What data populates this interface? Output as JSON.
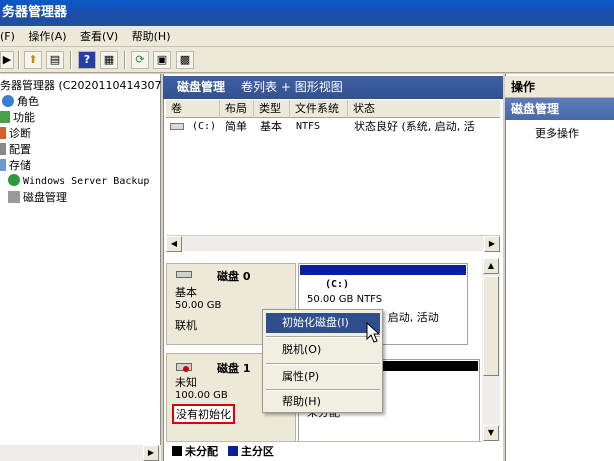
{
  "window": {
    "title": "务器管理器"
  },
  "menu": [
    "(F)",
    "操作(A)",
    "查看(V)",
    "帮助(H)"
  ],
  "tree": {
    "root": "务器管理器 (C2020110414307",
    "items": [
      "角色",
      "功能",
      "诊断",
      "配置",
      "存储"
    ],
    "storage_children": [
      "Windows Server Backup",
      "磁盘管理"
    ]
  },
  "mid_header": {
    "title": "磁盘管理",
    "view": "卷列表 + 图形视图"
  },
  "columns": [
    "卷",
    "布局",
    "类型",
    "文件系统",
    "状态"
  ],
  "volume_row": {
    "icon": "drive-icon",
    "volume": "(C:)",
    "layout": "简单",
    "type": "基本",
    "fs": "NTFS",
    "status": "状态良好 (系统, 启动, 活"
  },
  "disk0": {
    "name": "磁盘 0",
    "kind": "基本",
    "size": "50.00 GB",
    "state": "联机",
    "partition": {
      "label": "(C:)",
      "size_fs": "50.00 GB NTFS",
      "status": "状态良好 (系统, 启动, 活动"
    }
  },
  "disk1": {
    "name": "磁盘 1",
    "kind": "未知",
    "size": "100.00 GB",
    "state": "没有初始化",
    "partition_label": "未分配"
  },
  "context_menu": {
    "items": [
      "初始化磁盘(I)",
      "脱机(O)",
      "属性(P)",
      "帮助(H)"
    ]
  },
  "legend": {
    "unallocated": "未分配",
    "primary": "主分区"
  },
  "actions": {
    "title": "操作",
    "section": "磁盘管理",
    "more": "更多操作"
  },
  "colors": {
    "title_blue": "#1e4ea8",
    "primary_partition": "#0a1f9c",
    "highlight": "#e00000"
  }
}
